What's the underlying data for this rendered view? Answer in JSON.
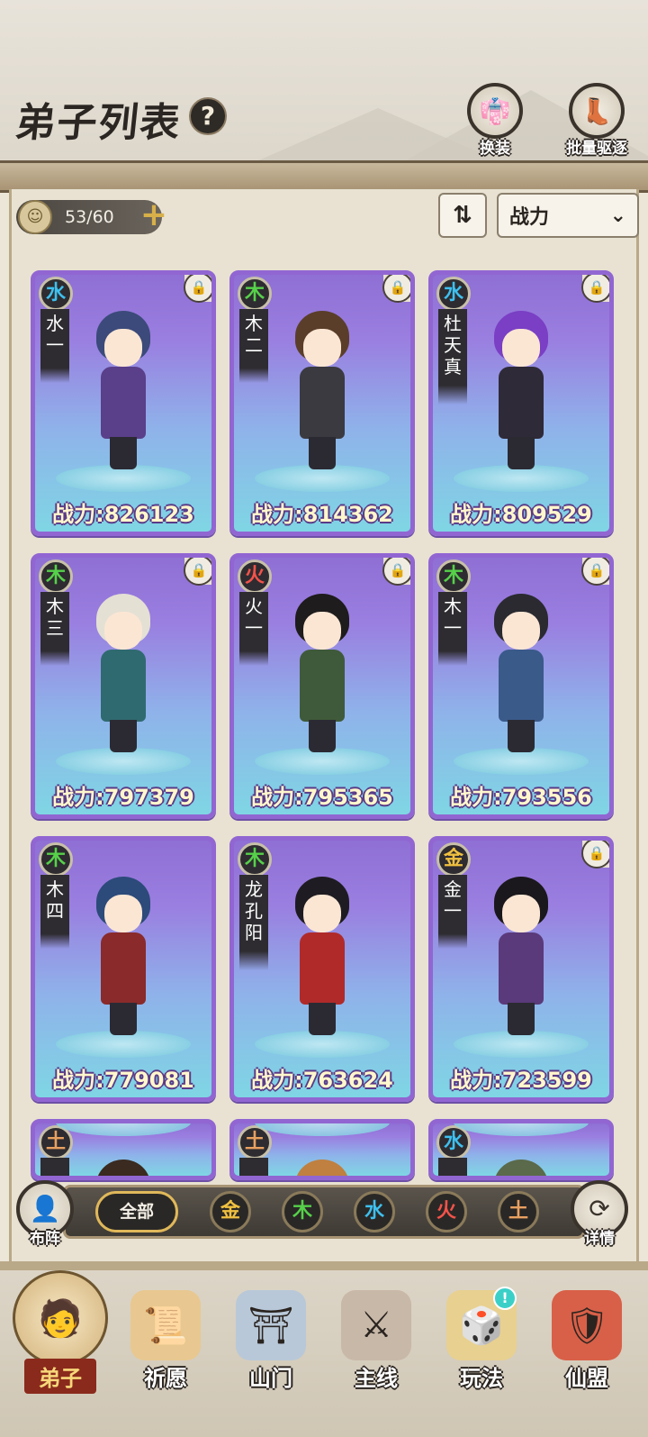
{
  "header": {
    "title": "弟子列表",
    "help_icon": "?",
    "buttons": [
      {
        "label": "换装",
        "icon": "robe-icon"
      },
      {
        "label": "批量驱逐",
        "icon": "boot-icon"
      }
    ]
  },
  "toolbar": {
    "count": "53/60",
    "sort_icon": "⇅",
    "sort_value": "战力",
    "dropdown_icon": "⌄"
  },
  "elements": {
    "water": "水",
    "wood": "木",
    "fire": "火",
    "metal": "金",
    "earth": "土"
  },
  "disciples": [
    {
      "element": "水",
      "element_key": "water",
      "name": [
        "水",
        "一"
      ],
      "power": "战力:826123",
      "locked": true,
      "hair": "#3b4a7a",
      "robe": "#5a3f8a"
    },
    {
      "element": "木",
      "element_key": "wood",
      "name": [
        "木",
        "二"
      ],
      "power": "战力:814362",
      "locked": true,
      "hair": "#5a3e2a",
      "robe": "#3a3a40"
    },
    {
      "element": "水",
      "element_key": "water",
      "name": [
        "杜",
        "天",
        "真"
      ],
      "power": "战力:809529",
      "locked": true,
      "hair": "#7a3fc4",
      "robe": "#2f2a38"
    },
    {
      "element": "木",
      "element_key": "wood",
      "name": [
        "木",
        "三"
      ],
      "power": "战力:797379",
      "locked": true,
      "hair": "#e4e0d4",
      "robe": "#2f6a70"
    },
    {
      "element": "火",
      "element_key": "fire",
      "name": [
        "火",
        "一"
      ],
      "power": "战力:795365",
      "locked": true,
      "hair": "#1e1c1c",
      "robe": "#3f5a3a"
    },
    {
      "element": "木",
      "element_key": "wood",
      "name": [
        "木",
        "一"
      ],
      "power": "战力:793556",
      "locked": true,
      "hair": "#2a2a30",
      "robe": "#3a5a8a"
    },
    {
      "element": "木",
      "element_key": "wood",
      "name": [
        "木",
        "四"
      ],
      "power": "战力:779081",
      "locked": false,
      "hair": "#2c4a7a",
      "robe": "#8a2a2a"
    },
    {
      "element": "木",
      "element_key": "wood",
      "name": [
        "龙",
        "孔",
        "阳"
      ],
      "power": "战力:763624",
      "locked": false,
      "hair": "#1e1c22",
      "robe": "#b02a2a"
    },
    {
      "element": "金",
      "element_key": "metal",
      "name": [
        "金",
        "一"
      ],
      "power": "战力:723599",
      "locked": true,
      "hair": "#1a181c",
      "robe": "#5a3a7a"
    },
    {
      "element": "土",
      "element_key": "earth",
      "name": [
        "",
        ""
      ],
      "power": "",
      "locked": false,
      "hair": "#3a2a20",
      "robe": "#6a4a30"
    },
    {
      "element": "土",
      "element_key": "earth",
      "name": [
        "",
        ""
      ],
      "power": "",
      "locked": false,
      "hair": "#c08040",
      "robe": "#6a4a30"
    },
    {
      "element": "水",
      "element_key": "water",
      "name": [
        "",
        ""
      ],
      "power": "",
      "locked": false,
      "hair": "#5a6a4a",
      "robe": "#4a4a4a"
    }
  ],
  "filter": {
    "left_button": "布阵",
    "right_button": "详情",
    "all_label": "全部",
    "options": [
      {
        "label": "金",
        "key": "metal"
      },
      {
        "label": "木",
        "key": "wood"
      },
      {
        "label": "水",
        "key": "water"
      },
      {
        "label": "火",
        "key": "fire"
      },
      {
        "label": "土",
        "key": "earth"
      }
    ]
  },
  "nav": [
    {
      "label": "弟子",
      "icon": "disciple-icon",
      "active": true
    },
    {
      "label": "祈愿",
      "icon": "wish-scroll-icon",
      "active": false
    },
    {
      "label": "山门",
      "icon": "gate-icon",
      "active": false
    },
    {
      "label": "主线",
      "icon": "sword-mountain-icon",
      "active": false
    },
    {
      "label": "玩法",
      "icon": "gameplay-icon",
      "active": false,
      "badge": "!"
    },
    {
      "label": "仙盟",
      "icon": "alliance-icon",
      "active": false
    }
  ]
}
